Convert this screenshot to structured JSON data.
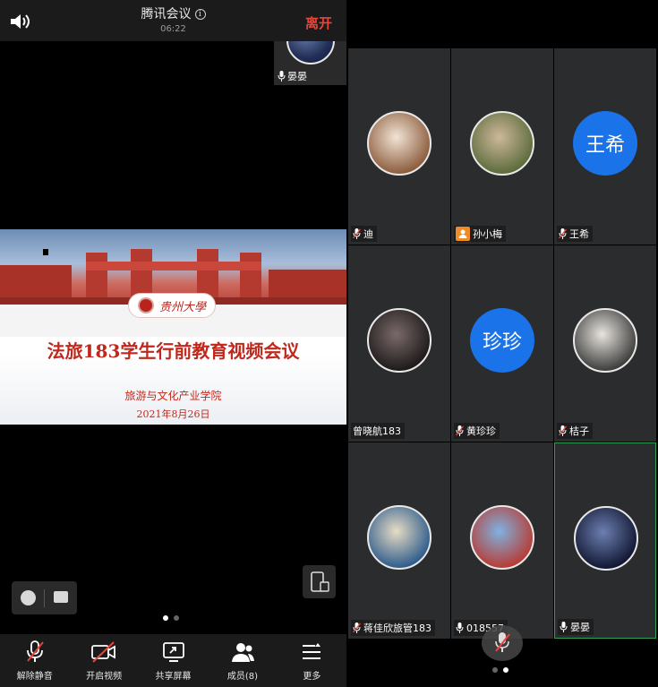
{
  "meeting": {
    "title": "腾讯会议",
    "timer": "06:22",
    "leave_label": "离开",
    "self_name": "晏晏"
  },
  "slide": {
    "logo_text": "贵州大學",
    "title": "法旅183学生行前教育视频会议",
    "org": "旅游与文化产业学院",
    "date": "2021年8月26日"
  },
  "toolbar": {
    "unmute": "解除静音",
    "video": "开启视频",
    "share": "共享屏幕",
    "members": "成员(8)",
    "more": "更多"
  },
  "participants": [
    {
      "name": "迪",
      "avatar": "photo",
      "mic": "muted",
      "colors": [
        "#f1e4d6",
        "#8a5a3a"
      ]
    },
    {
      "name": "孙小梅",
      "avatar": "photo",
      "mic": "user-icon",
      "colors": [
        "#cdb89a",
        "#5a6a3a"
      ]
    },
    {
      "name": "王希",
      "avatar": "text",
      "avatar_text": "王希",
      "mic": "muted"
    },
    {
      "name": "曾晓航183",
      "avatar": "photo",
      "mic": "none",
      "colors": [
        "#7a6a6a",
        "#1c1818"
      ]
    },
    {
      "name": "黄珍珍",
      "avatar": "text",
      "avatar_text": "珍珍",
      "mic": "muted"
    },
    {
      "name": "桔子",
      "avatar": "photo",
      "mic": "muted",
      "colors": [
        "#e8e4de",
        "#3a3a3a"
      ]
    },
    {
      "name": "蒋佳欣旅管183",
      "avatar": "photo",
      "mic": "muted",
      "colors": [
        "#e7dcc6",
        "#2b5a8a"
      ]
    },
    {
      "name": "018557",
      "avatar": "photo",
      "mic": "on",
      "colors": [
        "#7fb2e0",
        "#b83a32"
      ]
    },
    {
      "name": "晏晏",
      "avatar": "photo",
      "mic": "on",
      "colors": [
        "#6d7fb0",
        "#0f1530"
      ],
      "active": true
    }
  ],
  "colors": {
    "leave": "#e8443a",
    "slide_red": "#c0281d",
    "avatar_blue": "#1a73e8",
    "active_border": "#2ea04f",
    "user_icon_orange": "#f08a24"
  }
}
